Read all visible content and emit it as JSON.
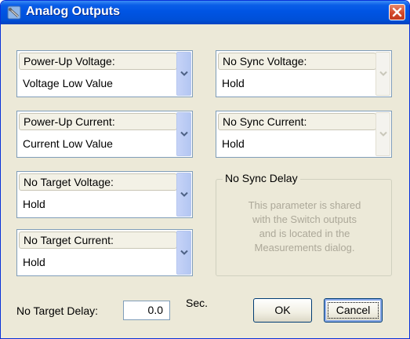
{
  "window": {
    "title": "Analog Outputs",
    "icon": "app-icon",
    "close_icon": "close-icon"
  },
  "fields": {
    "power_up_voltage": {
      "label": "Power-Up Voltage:",
      "value": "Voltage Low Value"
    },
    "power_up_current": {
      "label": "Power-Up Current:",
      "value": "Current Low Value"
    },
    "no_target_voltage": {
      "label": "No Target Voltage:",
      "value": "Hold"
    },
    "no_target_current": {
      "label": "No Target Current:",
      "value": "Hold"
    },
    "no_sync_voltage": {
      "label": "No Sync Voltage:",
      "value": "Hold"
    },
    "no_sync_current": {
      "label": "No Sync Current:",
      "value": "Hold"
    }
  },
  "no_sync_delay": {
    "title": "No Sync Delay",
    "lines": [
      "This parameter is shared",
      "with the Switch outputs",
      "and is located in the",
      "Measurements dialog."
    ]
  },
  "no_target_delay": {
    "label": "No Target Delay:",
    "value": "0.0",
    "unit": "Sec."
  },
  "buttons": {
    "ok": "OK",
    "cancel": "Cancel"
  },
  "icons": {
    "dropdown": "chevron-down-icon"
  },
  "colors": {
    "titlebar": "#0054e3",
    "dialog_bg": "#ece9d8",
    "close_button": "#d3482a",
    "disabled_text": "#aca899"
  }
}
